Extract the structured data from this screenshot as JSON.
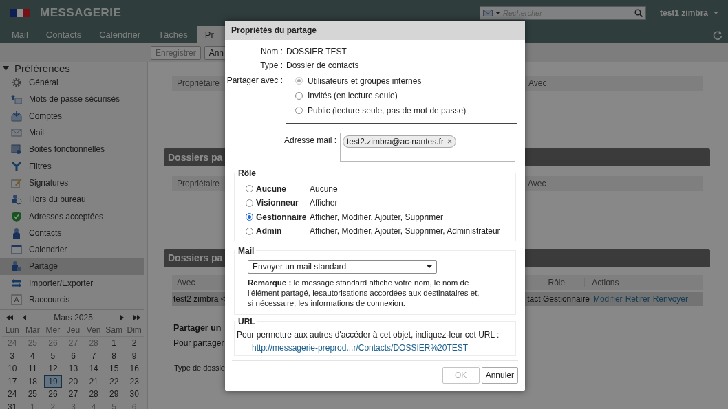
{
  "header": {
    "app_name": "MESSAGERIE",
    "search": {
      "placeholder": "Rechercher"
    },
    "user": "test1 zimbra"
  },
  "tabs": [
    {
      "label": "Mail",
      "selected": false
    },
    {
      "label": "Contacts",
      "selected": false
    },
    {
      "label": "Calendrier",
      "selected": false
    },
    {
      "label": "Tâches",
      "selected": false
    },
    {
      "label": "Pr",
      "selected": true
    }
  ],
  "toolbar": {
    "buttons": [
      {
        "label": "Enregistrer",
        "disabled": true
      },
      {
        "label": "Ann",
        "disabled": false
      }
    ]
  },
  "sidebar": {
    "title": "Préférences",
    "expanded": true,
    "items": [
      {
        "label": "Général",
        "selected": false
      },
      {
        "label": "Mots de passe sécurisés",
        "selected": false
      },
      {
        "label": "Comptes",
        "selected": false
      },
      {
        "label": "Mail",
        "selected": false
      },
      {
        "label": "Boites fonctionnelles",
        "selected": false
      },
      {
        "label": "Filtres",
        "selected": false
      },
      {
        "label": "Signatures",
        "selected": false
      },
      {
        "label": "Hors du bureau",
        "selected": false
      },
      {
        "label": "Adresses acceptées",
        "selected": false
      },
      {
        "label": "Contacts",
        "selected": false
      },
      {
        "label": "Calendrier",
        "selected": false
      },
      {
        "label": "Partage",
        "selected": true
      },
      {
        "label": "Importer/Exporter",
        "selected": false
      },
      {
        "label": "Raccourcis",
        "selected": false
      }
    ]
  },
  "mini_calendar": {
    "month": "Mars 2025",
    "weekdays": [
      "Lun",
      "Mar",
      "Mer",
      "Jeu",
      "Ven",
      "Sam",
      "Dim"
    ],
    "weeks": [
      [
        {
          "day": "24",
          "other_month": true,
          "selected": false
        },
        {
          "day": "25",
          "other_month": true,
          "selected": false
        },
        {
          "day": "26",
          "other_month": true,
          "selected": false
        },
        {
          "day": "27",
          "other_month": true,
          "selected": false
        },
        {
          "day": "28",
          "other_month": true,
          "selected": false
        },
        {
          "day": "1",
          "other_month": false,
          "selected": false
        },
        {
          "day": "2",
          "other_month": false,
          "selected": false
        }
      ],
      [
        {
          "day": "3",
          "other_month": false,
          "selected": false
        },
        {
          "day": "4",
          "other_month": false,
          "selected": false
        },
        {
          "day": "5",
          "other_month": false,
          "selected": false
        },
        {
          "day": "6",
          "other_month": false,
          "selected": false
        },
        {
          "day": "7",
          "other_month": false,
          "selected": false
        },
        {
          "day": "8",
          "other_month": false,
          "selected": false
        },
        {
          "day": "9",
          "other_month": false,
          "selected": false
        }
      ],
      [
        {
          "day": "10",
          "other_month": false,
          "selected": false
        },
        {
          "day": "11",
          "other_month": false,
          "selected": false
        },
        {
          "day": "12",
          "other_month": false,
          "selected": false
        },
        {
          "day": "13",
          "other_month": false,
          "selected": false
        },
        {
          "day": "14",
          "other_month": false,
          "selected": false
        },
        {
          "day": "15",
          "other_month": false,
          "selected": false
        },
        {
          "day": "16",
          "other_month": false,
          "selected": false
        }
      ],
      [
        {
          "day": "17",
          "other_month": false,
          "selected": false
        },
        {
          "day": "18",
          "other_month": false,
          "selected": false
        },
        {
          "day": "19",
          "other_month": false,
          "selected": true
        },
        {
          "day": "20",
          "other_month": false,
          "selected": false
        },
        {
          "day": "21",
          "other_month": false,
          "selected": false
        },
        {
          "day": "22",
          "other_month": false,
          "selected": false
        },
        {
          "day": "23",
          "other_month": false,
          "selected": false
        }
      ],
      [
        {
          "day": "24",
          "other_month": false,
          "selected": false
        },
        {
          "day": "25",
          "other_month": false,
          "selected": false
        },
        {
          "day": "26",
          "other_month": false,
          "selected": false
        },
        {
          "day": "27",
          "other_month": false,
          "selected": false
        },
        {
          "day": "28",
          "other_month": false,
          "selected": false
        },
        {
          "day": "29",
          "other_month": false,
          "selected": false
        },
        {
          "day": "30",
          "other_month": false,
          "selected": false
        }
      ],
      [
        {
          "day": "31",
          "other_month": false,
          "selected": false
        },
        {
          "day": "1",
          "other_month": true,
          "selected": false
        },
        {
          "day": "2",
          "other_month": true,
          "selected": false
        },
        {
          "day": "3",
          "other_month": true,
          "selected": false
        },
        {
          "day": "4",
          "other_month": true,
          "selected": false
        },
        {
          "day": "5",
          "other_month": true,
          "selected": false
        },
        {
          "day": "6",
          "other_month": true,
          "selected": false
        }
      ]
    ]
  },
  "content": {
    "table_1": {
      "columns": [
        "Propriétaire",
        "Avec"
      ]
    },
    "section_2": {
      "title": "Dossiers pa",
      "columns": [
        "Propriétaire",
        "Avec"
      ]
    },
    "section_3": {
      "title": "Dossiers pa",
      "columns": [
        "Avec",
        "Rôle",
        "Actions"
      ],
      "rows": [
        {
          "column_1": "test2 zimbra <",
          "column_2": "tact Gestionnaire",
          "actions": [
            "Modifier",
            "Retirer",
            "Renvoyer"
          ]
        }
      ]
    },
    "share_heading": "Partager un",
    "share_text": "Pour partager",
    "folder_type_label": "Type de dossie"
  },
  "dialog": {
    "title": "Propriétés du partage",
    "fields": [
      {
        "label": "Nom :",
        "value": "DOSSIER TEST"
      },
      {
        "label": "Type :",
        "value": "Dossier de contacts"
      }
    ],
    "share_with": {
      "label": "Partager avec :",
      "options": [
        {
          "label": "Utilisateurs et groupes internes",
          "selected": true,
          "disabled": true
        },
        {
          "label": "Invités (en lecture seule)",
          "selected": false,
          "disabled": false
        },
        {
          "label": "Public (lecture seule, pas de mot de passe)",
          "selected": false,
          "disabled": false
        }
      ]
    },
    "email": {
      "label": "Adresse mail :",
      "recipients": [
        "test2.zimbra@ac-nantes.fr"
      ]
    },
    "role": {
      "legend": "Rôle",
      "options": [
        {
          "name": "Aucune",
          "description": "Aucune",
          "selected": false
        },
        {
          "name": "Visionneur",
          "description": "Afficher",
          "selected": false
        },
        {
          "name": "Gestionnaire",
          "description": "Afficher, Modifier, Ajouter, Supprimer",
          "selected": true
        },
        {
          "name": "Admin",
          "description": "Afficher, Modifier, Ajouter, Supprimer, Administrateur",
          "selected": false
        }
      ]
    },
    "mail": {
      "legend": "Mail",
      "select_value": "Envoyer un mail standard",
      "note": "**Remarque :** le message standard affiche votre nom, le nom de l'élément partagé, lesautorisations accordées aux destinataires et, si nécessaire, les informations de connexion."
    },
    "url": {
      "legend": "URL",
      "text": "Pour permettre aux autres d'accéder à cet objet, indiquez-leur cet URL :",
      "link": "http://messagerie-preprod...r/Contacts/DOSSIER%20TEST"
    },
    "buttons": [
      {
        "label": "OK",
        "disabled": true
      },
      {
        "label": "Annuler",
        "disabled": false
      }
    ]
  }
}
